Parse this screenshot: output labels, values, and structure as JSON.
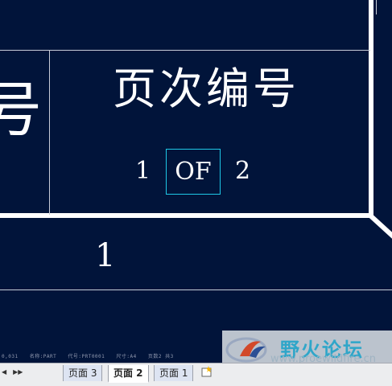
{
  "drawing": {
    "big_char": "号",
    "heading": "页次编号",
    "page_current": "1",
    "of_label": "OF",
    "page_total": "2",
    "sheet_value": "1"
  },
  "status_line": [
    "0,031",
    "名称:PART",
    "代号:PRT0001",
    "尺寸:A4",
    "页数2 共3"
  ],
  "watermark": {
    "title": "野火论坛",
    "url": "www.proewildfire.cn"
  },
  "tabs": [
    {
      "label": "页面 3",
      "active": false
    },
    {
      "label": "页面 2",
      "active": true
    },
    {
      "label": "页面 1",
      "active": false
    }
  ],
  "icons": {
    "nav_prev": "triangle-left",
    "nav_next": "double-triangle-right",
    "new_sheet": "new-sheet-icon"
  },
  "colors": {
    "background": "#01143a",
    "line": "#ffffff",
    "highlight": "#1ec8e6",
    "tabbar": "#ecedef"
  }
}
